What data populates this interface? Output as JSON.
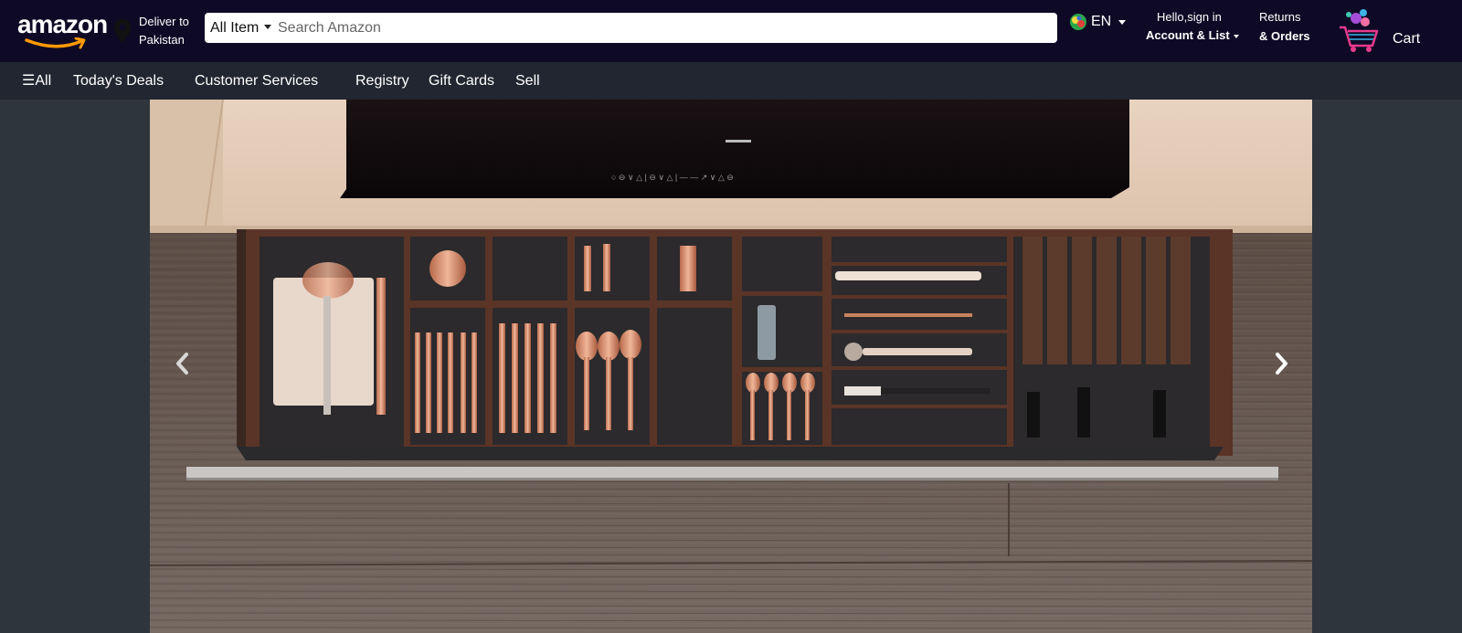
{
  "header": {
    "logo": "amazon",
    "deliver": {
      "line1": "Deliver to",
      "line2": "Pakistan",
      "icon": "location-pin-icon"
    },
    "search": {
      "category": "All Item",
      "placeholder": "Search Amazon"
    },
    "language": {
      "code": "EN",
      "icon": "flag-icon"
    },
    "account": {
      "line1": "Hello,sign in",
      "line2": "Account & List"
    },
    "returns": {
      "line1": "Returns",
      "line2": "& Orders"
    },
    "cart": {
      "label": "Cart",
      "icon": "shopping-cart-icon"
    }
  },
  "nav": {
    "items": [
      {
        "label": "☰All"
      },
      {
        "label": "Today's Deals"
      },
      {
        "label": "Customer Services"
      },
      {
        "label": "Registry"
      },
      {
        "label": "Gift Cards"
      },
      {
        "label": "Sell"
      }
    ]
  },
  "hero": {
    "image": "kitchen drawer with copper cutlery organizer",
    "prev_icon": "chevron-left-icon",
    "next_icon": "chevron-right-icon"
  },
  "colors": {
    "header_bg": "#0e0a26",
    "nav_bg": "#222630",
    "page_bg": "#2f353c",
    "accent": "#ff9900"
  }
}
